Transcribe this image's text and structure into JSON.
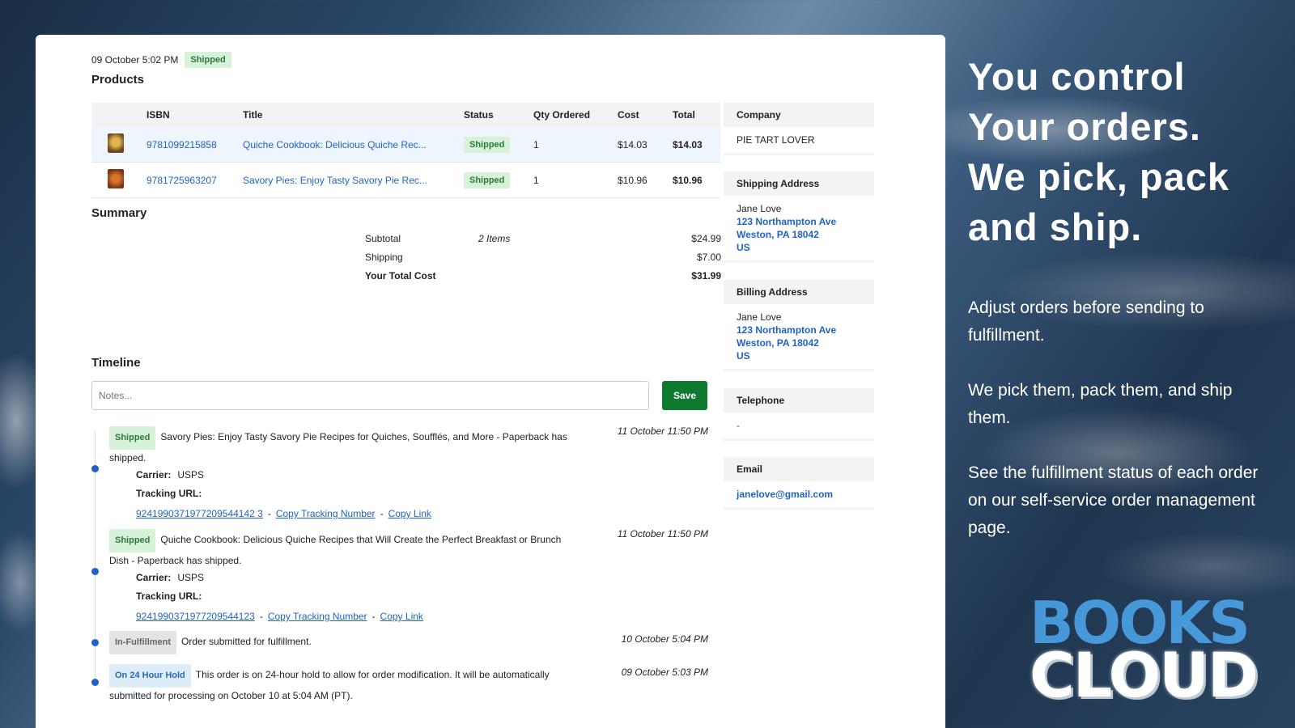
{
  "order": {
    "datetime": "09 October 5:02 PM",
    "status": "Shipped"
  },
  "products": {
    "heading": "Products",
    "columns": [
      "",
      "ISBN",
      "Title",
      "Status",
      "Qty Ordered",
      "Cost",
      "Total"
    ],
    "rows": [
      {
        "thumb": "book-cover-quiche",
        "isbn": "9781099215858",
        "title": "Quiche Cookbook: Delicious Quiche Rec...",
        "status": "Shipped",
        "qty": "1",
        "cost": "$14.03",
        "total": "$14.03"
      },
      {
        "thumb": "book-cover-savory-pies",
        "isbn": "9781725963207",
        "title": "Savory Pies: Enjoy Tasty Savory Pie Rec...",
        "status": "Shipped",
        "qty": "1",
        "cost": "$10.96",
        "total": "$10.96"
      }
    ]
  },
  "summary": {
    "heading": "Summary",
    "subtotal_label": "Subtotal",
    "items_count": "2 Items",
    "subtotal": "$24.99",
    "shipping_label": "Shipping",
    "shipping": "$7.00",
    "total_label": "Your Total Cost",
    "total": "$31.99"
  },
  "timeline": {
    "heading": "Timeline",
    "notes_placeholder": "Notes...",
    "save_label": "Save",
    "entries": [
      {
        "badge": "Shipped",
        "text": "Savory Pies: Enjoy Tasty Savory Pie Recipes for Quiches, Soufflés, and More - Paperback has shipped.",
        "date": "11 October 11:50 PM",
        "carrier_label": "Carrier:",
        "carrier": "USPS",
        "tracking_label": "Tracking URL:",
        "tracking_number": "9241990371977209544142 3",
        "copy_tracking": "Copy Tracking Number",
        "copy_link": "Copy Link"
      },
      {
        "badge": "Shipped",
        "text": "Quiche Cookbook: Delicious Quiche Recipes that Will Create the Perfect Breakfast or Brunch Dish - Paperback has shipped.",
        "date": "11 October 11:50 PM",
        "carrier_label": "Carrier:",
        "carrier": "USPS",
        "tracking_label": "Tracking URL:",
        "tracking_number": "9241990371977209544123",
        "copy_tracking": "Copy Tracking Number",
        "copy_link": "Copy Link"
      },
      {
        "badge": "In-Fulfillment",
        "text": "Order submitted for fulfillment.",
        "date": "10 October 5:04 PM"
      },
      {
        "badge": "On 24 Hour Hold",
        "text": "This order is on 24-hour hold to allow for order modification. It will be automatically submitted for processing on October 10 at 5:04 AM (PT).",
        "date": "09 October 5:03 PM"
      }
    ]
  },
  "sidebar": {
    "company_label": "Company",
    "company": "PIE TART LOVER",
    "shipping_label": "Shipping Address",
    "shipping_name": "Jane Love",
    "shipping_street": "123 Northampton Ave",
    "shipping_city": "Weston, PA 18042",
    "shipping_country": "US",
    "billing_label": "Billing Address",
    "billing_name": "Jane Love",
    "billing_street": "123 Northampton Ave",
    "billing_city": "Weston, PA 18042",
    "billing_country": "US",
    "telephone_label": "Telephone",
    "telephone": "-",
    "email_label": "Email",
    "email": "janelove@gmail.com"
  },
  "marketing": {
    "headline_1": "You control",
    "headline_2": "Your orders.",
    "headline_3": "We pick, pack",
    "headline_4": "and ship.",
    "para_1": "Adjust orders before sending to fulfillment.",
    "para_2": "We pick them, pack them, and ship them.",
    "para_3": "See the fulfillment status of each order on our self-service order management page."
  },
  "logo": {
    "line_1": "BOOKS",
    "line_2": "CLOUD"
  },
  "colors": {
    "accent": "#1f63c6",
    "save": "#0d7a2f",
    "shipped_bg": "#d6f2d9"
  }
}
